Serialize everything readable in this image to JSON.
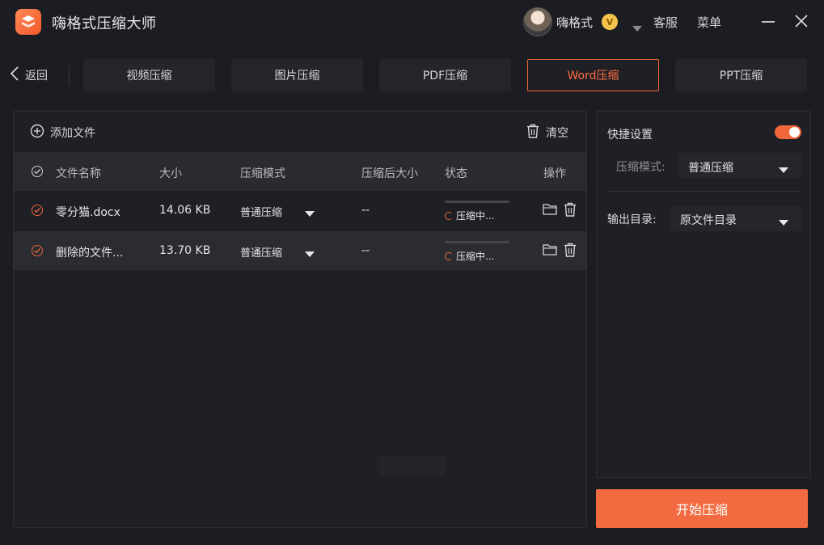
{
  "app": {
    "title": "嗨格式压缩大师",
    "username": "嗨格式",
    "vip_badge": "V",
    "service_label": "客服",
    "menu_label": "菜单"
  },
  "nav": {
    "back_label": "返回",
    "tabs": [
      {
        "label": "视频压缩",
        "active": false
      },
      {
        "label": "图片压缩",
        "active": false
      },
      {
        "label": "PDF压缩",
        "active": false
      },
      {
        "label": "Word压缩",
        "active": true
      },
      {
        "label": "PPT压缩",
        "active": false
      }
    ]
  },
  "toolbar": {
    "add_file_label": "添加文件",
    "clear_label": "清空"
  },
  "table": {
    "headers": {
      "name": "文件名称",
      "size": "大小",
      "mode": "压缩模式",
      "compressed_size": "压缩后大小",
      "status": "状态",
      "actions": "操作"
    },
    "rows": [
      {
        "name": "零分猫.docx",
        "size": "14.06 KB",
        "mode": "普通压缩",
        "compressed_size": "--",
        "status": "压缩中...",
        "progress": 0
      },
      {
        "name": "删除的文件...",
        "size": "13.70 KB",
        "mode": "普通压缩",
        "compressed_size": "--",
        "status": "压缩中...",
        "progress": 0
      }
    ]
  },
  "settings": {
    "title": "快捷设置",
    "toggle_on": true,
    "mode_label": "压缩模式:",
    "mode_value": "普通压缩",
    "output_label": "输出目录:",
    "output_value": "原文件目录"
  },
  "actions": {
    "start_label": "开始压缩"
  },
  "colors": {
    "accent": "#f26a3f",
    "background": "#1c1d22",
    "panel": "#1f2025"
  }
}
